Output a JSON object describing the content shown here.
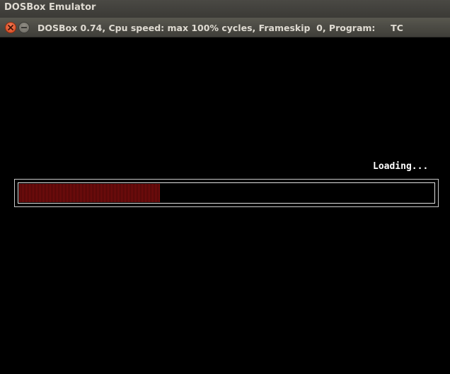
{
  "app_bar": {
    "title": "DOSBox Emulator"
  },
  "window": {
    "title": "DOSBox 0.74, Cpu speed: max 100% cycles, Frameskip  0, Program:     TC",
    "buttons": {
      "close_icon": "close-icon",
      "minimize_icon": "minimize-icon"
    }
  },
  "screen": {
    "loading_label": "Loading...",
    "progress": {
      "fraction": 0.34,
      "fill_color": "#8a1010"
    }
  },
  "colors": {
    "background": "#000000",
    "close_button": "#e0552b",
    "text": "#ffffff"
  }
}
